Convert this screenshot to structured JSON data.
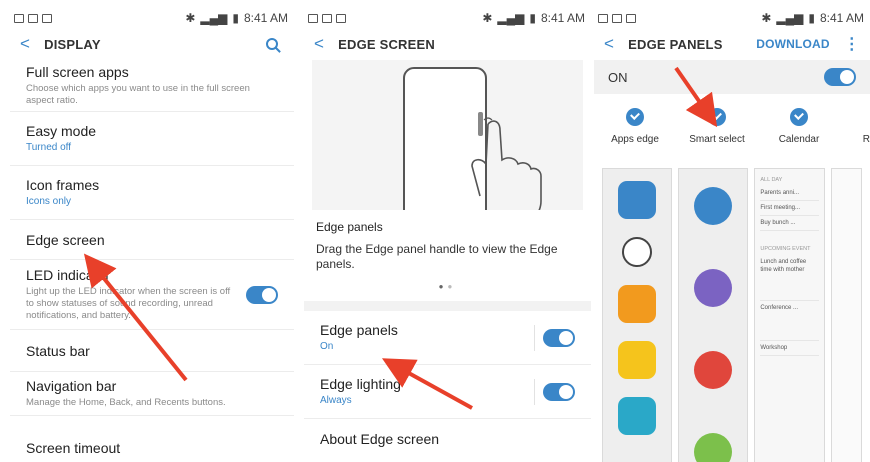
{
  "status": {
    "time": "8:41 AM"
  },
  "display": {
    "title": "DISPLAY",
    "items": [
      {
        "title": "Full screen apps",
        "sub": "Choose which apps you want to use in the full screen aspect ratio."
      },
      {
        "title": "Easy mode",
        "sub": "Turned off"
      },
      {
        "title": "Icon frames",
        "sub": "Icons only"
      },
      {
        "title": "Edge screen",
        "sub": ""
      },
      {
        "title": "LED indicator",
        "sub": "Light up the LED indicator when the screen is off to show statuses of sound recording, unread notifications, and battery."
      },
      {
        "title": "Status bar",
        "sub": ""
      },
      {
        "title": "Navigation bar",
        "sub": "Manage the Home, Back, and Recents buttons."
      },
      {
        "title": "Screen timeout",
        "sub": ""
      }
    ]
  },
  "edge_screen": {
    "title": "EDGE SCREEN",
    "card_title": "Edge panels",
    "card_desc": "Drag the Edge panel handle to view the Edge panels.",
    "rows": [
      {
        "title": "Edge panels",
        "sub": "On"
      },
      {
        "title": "Edge lighting",
        "sub": "Always"
      },
      {
        "title": "About Edge screen",
        "sub": ""
      }
    ]
  },
  "edge_panels": {
    "title": "EDGE PANELS",
    "download": "DOWNLOAD",
    "on_label": "ON",
    "panels": [
      "Apps edge",
      "Smart select",
      "Calendar",
      "R"
    ],
    "tasks": {
      "all_day": "ALL DAY",
      "items": [
        "Parents anni...",
        "First meeting...",
        "Buy bunch ..."
      ],
      "upcoming": "UPCOMING EVENT",
      "events": [
        "Lunch and coffee time with mother",
        "Conference ...",
        "Workshop"
      ]
    }
  },
  "colors": {
    "accent": "#3a86c8",
    "arrow": "#e8402a"
  }
}
